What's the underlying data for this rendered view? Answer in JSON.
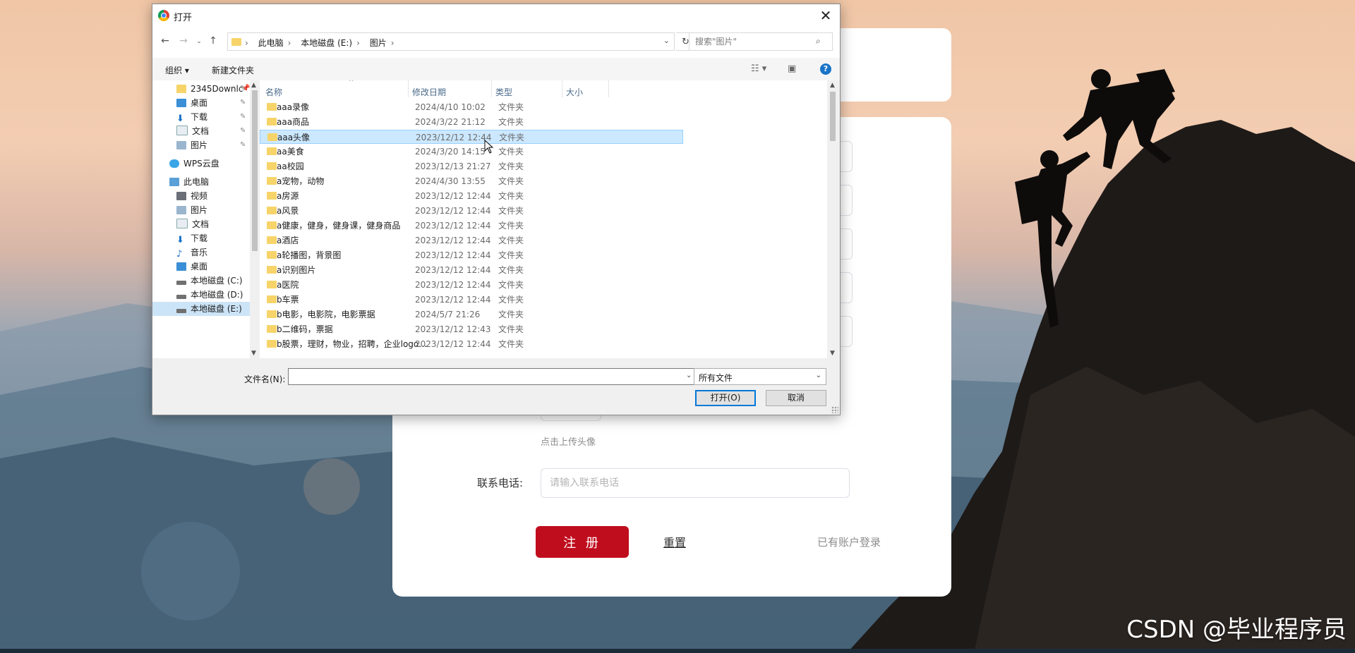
{
  "dialog": {
    "title": "打开",
    "breadcrumb": [
      "此电脑",
      "本地磁盘 (E:)",
      "图片"
    ],
    "search_placeholder": "搜索\"图片\"",
    "toolbar": {
      "organize": "组织 ▾",
      "new_folder": "新建文件夹"
    },
    "nav_items": [
      {
        "label": "2345Downlc",
        "icon": "folder-icon",
        "pinned": true
      },
      {
        "label": "桌面",
        "icon": "desktop-icon",
        "pinned": true
      },
      {
        "label": "下载",
        "icon": "download-icon",
        "pinned": true
      },
      {
        "label": "文档",
        "icon": "document-icon",
        "pinned": true
      },
      {
        "label": "图片",
        "icon": "picture-icon",
        "pinned": true
      },
      {
        "label": "WPS云盘",
        "icon": "cloud-icon"
      },
      {
        "label": "此电脑",
        "icon": "computer-icon"
      },
      {
        "label": "视频",
        "icon": "video-icon"
      },
      {
        "label": "图片",
        "icon": "picture-icon"
      },
      {
        "label": "文档",
        "icon": "document-icon"
      },
      {
        "label": "下载",
        "icon": "download-icon"
      },
      {
        "label": "音乐",
        "icon": "music-icon"
      },
      {
        "label": "桌面",
        "icon": "desktop-icon"
      },
      {
        "label": "本地磁盘 (C:)",
        "icon": "drive-icon"
      },
      {
        "label": "本地磁盘 (D:)",
        "icon": "drive-icon"
      },
      {
        "label": "本地磁盘 (E:)",
        "icon": "drive-icon",
        "selected": true
      }
    ],
    "columns": {
      "name": "名称",
      "date": "修改日期",
      "type": "类型",
      "size": "大小"
    },
    "files": [
      {
        "name": "aaa录像",
        "date": "2024/4/10 10:02",
        "type": "文件夹"
      },
      {
        "name": "aaa商品",
        "date": "2024/3/22 21:12",
        "type": "文件夹"
      },
      {
        "name": "aaa头像",
        "date": "2023/12/12 12:44",
        "type": "文件夹",
        "selected": true
      },
      {
        "name": "aa美食",
        "date": "2024/3/20 14:15",
        "type": "文件夹"
      },
      {
        "name": "aa校园",
        "date": "2023/12/13 21:27",
        "type": "文件夹"
      },
      {
        "name": "a宠物，动物",
        "date": "2024/4/30 13:55",
        "type": "文件夹"
      },
      {
        "name": "a房源",
        "date": "2023/12/12 12:44",
        "type": "文件夹"
      },
      {
        "name": "a风景",
        "date": "2023/12/12 12:44",
        "type": "文件夹"
      },
      {
        "name": "a健康，健身，健身课，健身商品",
        "date": "2023/12/12 12:44",
        "type": "文件夹"
      },
      {
        "name": "a酒店",
        "date": "2023/12/12 12:44",
        "type": "文件夹"
      },
      {
        "name": "a轮播图，背景图",
        "date": "2023/12/12 12:44",
        "type": "文件夹"
      },
      {
        "name": "a识别图片",
        "date": "2023/12/12 12:44",
        "type": "文件夹"
      },
      {
        "name": "a医院",
        "date": "2023/12/12 12:44",
        "type": "文件夹"
      },
      {
        "name": "b车票",
        "date": "2023/12/12 12:44",
        "type": "文件夹"
      },
      {
        "name": "b电影，电影院，电影票据",
        "date": "2024/5/7 21:26",
        "type": "文件夹"
      },
      {
        "name": "b二维码，票据",
        "date": "2023/12/12 12:43",
        "type": "文件夹"
      },
      {
        "name": "b股票，理财，物业，招聘，企业logo，...",
        "date": "2023/12/12 12:44",
        "type": "文件夹"
      }
    ],
    "filename_label": "文件名(N):",
    "filename_value": "",
    "filetype": "所有文件",
    "open_button": "打开(O)",
    "cancel_button": "取消"
  },
  "form": {
    "upload_hint": "点击上传头像",
    "phone_label": "联系电话:",
    "phone_placeholder": "请输入联系电话",
    "register_button": "注 册",
    "reset_link": "重置",
    "login_link": "已有账户登录"
  },
  "watermark": "CSDN @毕业程序员",
  "colors": {
    "primary_button": "#c00d1e",
    "selection": "#cce8ff",
    "nav_selection": "#cce4f7"
  }
}
